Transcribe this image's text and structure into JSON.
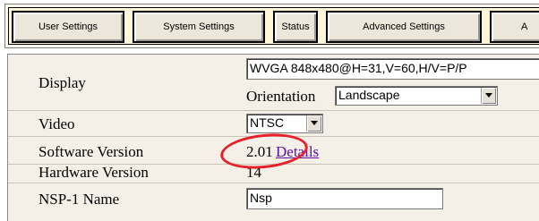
{
  "tabs": [
    {
      "label": "User Settings"
    },
    {
      "label": "System Settings"
    },
    {
      "label": "Status"
    },
    {
      "label": "Advanced Settings"
    },
    {
      "label": "A"
    }
  ],
  "settings": {
    "display": {
      "label": "Display",
      "resolution_value": "WVGA 848x480@H=31,V=60,H/V=P/P",
      "orientation_label": "Orientation",
      "orientation_value": "Landscape"
    },
    "video": {
      "label": "Video",
      "value": "NTSC"
    },
    "software_version": {
      "label": "Software Version",
      "value": "2.01",
      "details_link": "Details"
    },
    "hardware_version": {
      "label": "Hardware Version",
      "value": "14"
    },
    "nsp_name": {
      "label": "NSP-1 Name",
      "value": "Nsp"
    }
  },
  "annotation": {
    "color": "#e8202a"
  }
}
